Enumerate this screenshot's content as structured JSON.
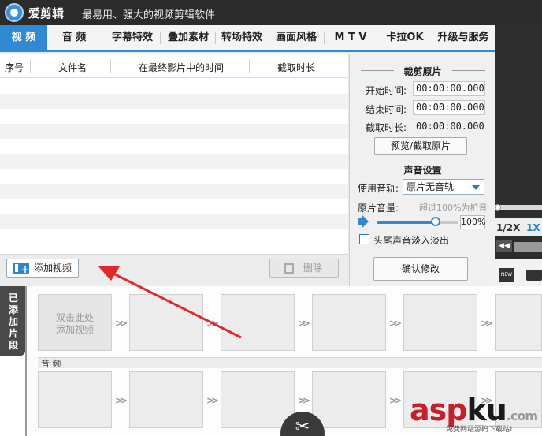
{
  "window": {
    "app_name": "爱剪辑",
    "slogan": "最易用、强大的视频剪辑软件"
  },
  "tabs": [
    {
      "label": "视 频",
      "active": true
    },
    {
      "label": "音 频"
    },
    {
      "label": "字幕特效"
    },
    {
      "label": "叠加素材"
    },
    {
      "label": "转场特效"
    },
    {
      "label": "画面风格"
    },
    {
      "label": "M T V"
    },
    {
      "label": "卡拉OK"
    },
    {
      "label": "升级与服务"
    }
  ],
  "list": {
    "columns": [
      "序号",
      "文件名",
      "在最终影片中的时间",
      "截取时长"
    ],
    "add_video_label": "添加视频",
    "delete_label": "删除"
  },
  "settings": {
    "trim_title": "裁剪原片",
    "start_label": "开始时间:",
    "start_value": "00:00:00.000",
    "end_label": "结束时间:",
    "end_value": "00:00:00.000",
    "duration_label": "截取时长:",
    "duration_value": "00:00:00.000",
    "preview_button": "预览/截取原片",
    "audio_title": "声音设置",
    "track_label": "使用音轨:",
    "track_value": "原片无音轨",
    "volume_label": "原片音量:",
    "volume_hint": "超过100%为扩音",
    "volume_value": "100%",
    "volume_level": 0.72,
    "fade_label": "头尾声音淡入淡出",
    "confirm_button": "确认修改"
  },
  "player": {
    "speed_half": "1/2X",
    "speed_one": "1X",
    "new_icon_text": "NEW"
  },
  "clips": {
    "side_tab": "已添加片段",
    "first_clip_line1": "双击此处",
    "first_clip_line2": "添加视频",
    "audio_label": "音 频"
  },
  "watermark": {
    "main_a": "asp",
    "main_k": "ku",
    "tld": ".com",
    "sub": "免费网站源码下载站!"
  },
  "colors": {
    "accent": "#2f8ad3",
    "title_bar": "#2b2b2b",
    "annotation": "#e02a2a",
    "watermark": "#c81e2a"
  }
}
